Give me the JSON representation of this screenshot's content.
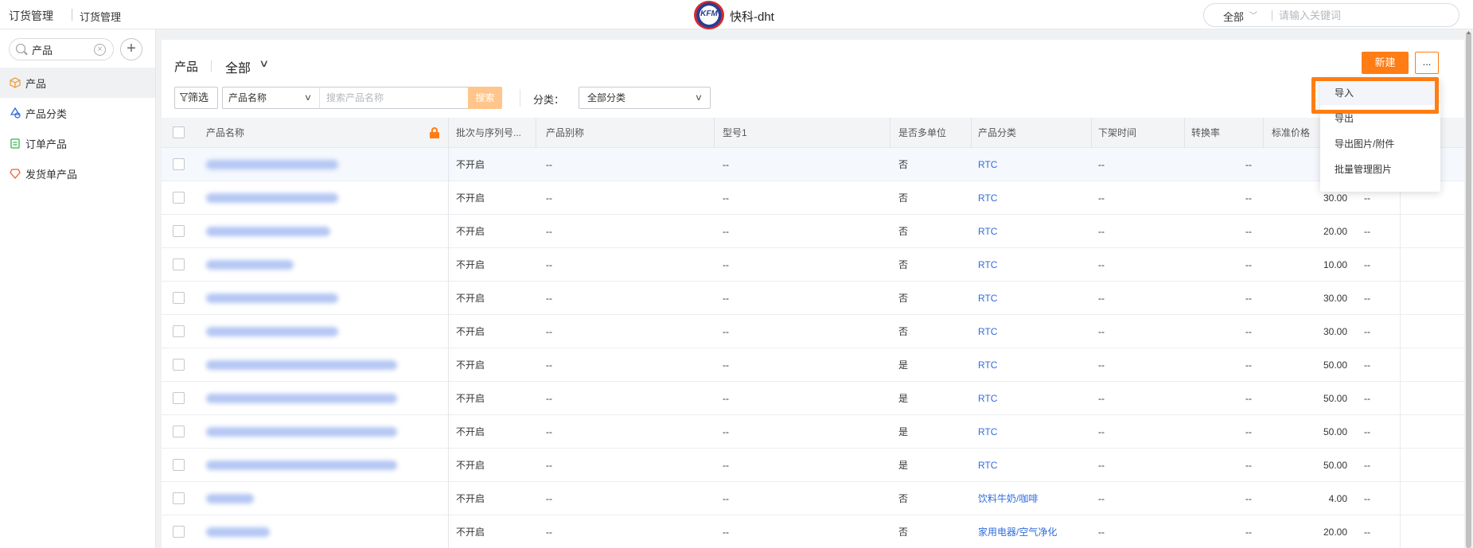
{
  "topbar": {
    "title": "订货管理",
    "subtitle": "订货管理",
    "logo_text": "KFM",
    "brand": "快科-dht",
    "search_scope": "全部",
    "search_placeholder": "请输入关键词"
  },
  "sidebar": {
    "search_value": "产品",
    "items": [
      {
        "label": "产品",
        "icon": "box-icon",
        "color": "#f0a040",
        "active": true
      },
      {
        "label": "产品分类",
        "icon": "category-icon",
        "color": "#2f6bdf",
        "active": false
      },
      {
        "label": "订单产品",
        "icon": "order-icon",
        "color": "#37b24d",
        "active": false
      },
      {
        "label": "发货单产品",
        "icon": "shipment-icon",
        "color": "#e8603c",
        "active": false
      }
    ]
  },
  "main": {
    "title": "产品",
    "scope": "全部",
    "new_label": "新建",
    "more_label": "...",
    "filter_label": "筛选",
    "field_select": "产品名称",
    "search_placeholder": "搜索产品名称",
    "search_label": "搜索",
    "category_label": "分类：",
    "category_value": "全部分类"
  },
  "table": {
    "columns": [
      "产品名称",
      "批次与序列号...",
      "产品别称",
      "型号1",
      "是否多单位",
      "产品分类",
      "下架时间",
      "转换率",
      "标准价格"
    ],
    "rows": [
      {
        "name_w": 166,
        "batch": "不开启",
        "alias": "--",
        "model": "--",
        "multi": "否",
        "cat": "RTC",
        "off": "--",
        "rate": "--",
        "price": "",
        "extra": ""
      },
      {
        "name_w": 166,
        "batch": "不开启",
        "alias": "--",
        "model": "--",
        "multi": "否",
        "cat": "RTC",
        "off": "--",
        "rate": "--",
        "price": "30.00",
        "extra": "--"
      },
      {
        "name_w": 156,
        "batch": "不开启",
        "alias": "--",
        "model": "--",
        "multi": "否",
        "cat": "RTC",
        "off": "--",
        "rate": "--",
        "price": "20.00",
        "extra": "--"
      },
      {
        "name_w": 110,
        "batch": "不开启",
        "alias": "--",
        "model": "--",
        "multi": "否",
        "cat": "RTC",
        "off": "--",
        "rate": "--",
        "price": "10.00",
        "extra": "--"
      },
      {
        "name_w": 166,
        "batch": "不开启",
        "alias": "--",
        "model": "--",
        "multi": "否",
        "cat": "RTC",
        "off": "--",
        "rate": "--",
        "price": "30.00",
        "extra": "--"
      },
      {
        "name_w": 166,
        "batch": "不开启",
        "alias": "--",
        "model": "--",
        "multi": "否",
        "cat": "RTC",
        "off": "--",
        "rate": "--",
        "price": "30.00",
        "extra": "--"
      },
      {
        "name_w": 240,
        "batch": "不开启",
        "alias": "--",
        "model": "--",
        "multi": "是",
        "cat": "RTC",
        "off": "--",
        "rate": "--",
        "price": "50.00",
        "extra": "--"
      },
      {
        "name_w": 240,
        "batch": "不开启",
        "alias": "--",
        "model": "--",
        "multi": "是",
        "cat": "RTC",
        "off": "--",
        "rate": "--",
        "price": "50.00",
        "extra": "--"
      },
      {
        "name_w": 240,
        "batch": "不开启",
        "alias": "--",
        "model": "--",
        "multi": "是",
        "cat": "RTC",
        "off": "--",
        "rate": "--",
        "price": "50.00",
        "extra": "--"
      },
      {
        "name_w": 240,
        "batch": "不开启",
        "alias": "--",
        "model": "--",
        "multi": "是",
        "cat": "RTC",
        "off": "--",
        "rate": "--",
        "price": "50.00",
        "extra": "--"
      },
      {
        "name_w": 60,
        "batch": "不开启",
        "alias": "--",
        "model": "--",
        "multi": "否",
        "cat": "饮料牛奶/咖啡",
        "off": "--",
        "rate": "--",
        "price": "4.00",
        "extra": "--"
      },
      {
        "name_w": 80,
        "batch": "不开启",
        "alias": "--",
        "model": "--",
        "multi": "否",
        "cat": "家用电器/空气净化",
        "off": "--",
        "rate": "--",
        "price": "20.00",
        "extra": "--"
      }
    ]
  },
  "dropdown": {
    "items": [
      "导入",
      "导出",
      "导出图片/附件",
      "批量管理图片"
    ]
  },
  "colors": {
    "accent": "#ff7d14",
    "link": "#2f6bdf"
  }
}
